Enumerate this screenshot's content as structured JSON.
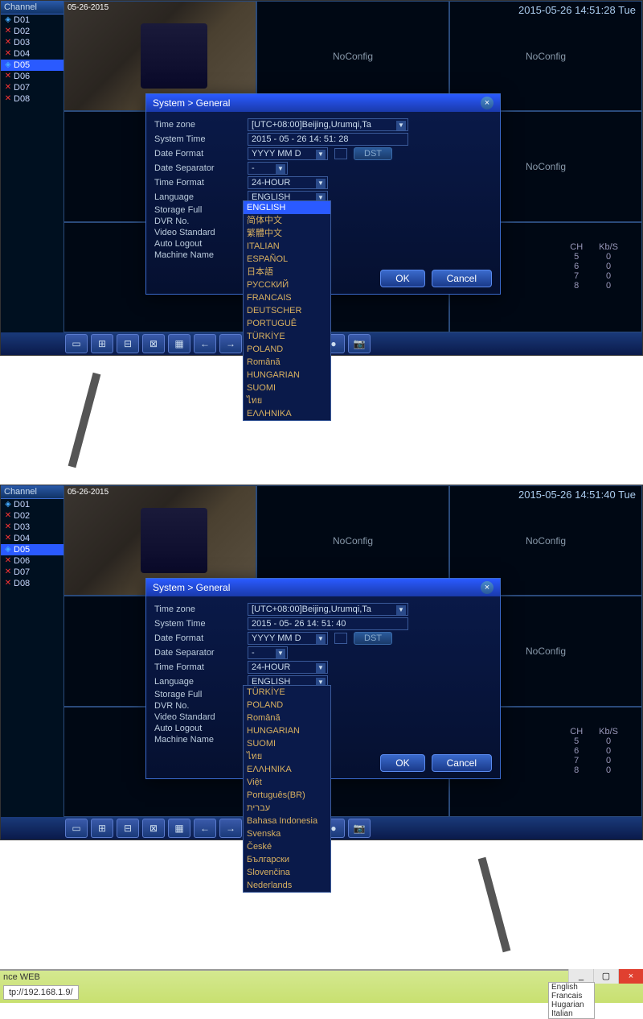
{
  "sidebar": {
    "title": "Channel",
    "channels": [
      {
        "id": "D01",
        "status": "rec"
      },
      {
        "id": "D02",
        "status": "x"
      },
      {
        "id": "D03",
        "status": "x"
      },
      {
        "id": "D04",
        "status": "x"
      },
      {
        "id": "D05",
        "status": "rec",
        "sel": true
      },
      {
        "id": "D06",
        "status": "x"
      },
      {
        "id": "D07",
        "status": "x"
      },
      {
        "id": "D08",
        "status": "x"
      }
    ]
  },
  "screen1": {
    "clock": "2015-05-26 14:51:28 Tue",
    "cam_ts": "05-26-2015",
    "noconfig": "NoConfig",
    "kbs": {
      "hdr_ch": "CH",
      "hdr_kb": "Kb/S",
      "rows": [
        [
          "5",
          "0"
        ],
        [
          "6",
          "0"
        ],
        [
          "7",
          "0"
        ],
        [
          "8",
          "0"
        ]
      ]
    },
    "dialog": {
      "title": "System > General",
      "labels": {
        "tz": "Time zone",
        "systime": "System Time",
        "datefmt": "Date Format",
        "datesep": "Date Separator",
        "timefmt": "Time Format",
        "lang": "Language",
        "storage": "Storage Full",
        "dvrno": "DVR No.",
        "vstd": "Video Standard",
        "autolog": "Auto Logout",
        "mname": "Machine Name"
      },
      "values": {
        "tz": "[UTC+08:00]Beijing,Urumqi,Ta",
        "systime": "2015 - 05 - 26  14: 51: 28",
        "datefmt": "YYYY MM D",
        "datesep": "-",
        "timefmt": "24-HOUR",
        "lang": "ENGLISH"
      },
      "dst": "DST",
      "langs": [
        "ENGLISH",
        "简体中文",
        "繁體中文",
        "ITALIAN",
        "ESPAÑOL",
        "日本語",
        "РУССКИЙ",
        "FRANCAIS",
        "DEUTSCHER",
        "PORTUGUÊ",
        "TÜRKİYE",
        "POLAND",
        "Română",
        "HUNGARIAN",
        "SUOMI",
        "ไทย",
        "ΕΛΛΗΝΙΚΑ"
      ],
      "ok": "OK",
      "cancel": "Cancel"
    }
  },
  "screen2": {
    "clock": "2015-05-26 14:51:40 Tue",
    "cam_ts": "05-26-2015",
    "dialog": {
      "values": {
        "systime": "2015 - 05- 26  14: 51: 40"
      },
      "langs": [
        "TÜRKİYE",
        "POLAND",
        "Română",
        "HUNGARIAN",
        "SUOMI",
        "ไทย",
        "ΕΛΛΗΝΙΚΑ",
        "Việt",
        "Português(BR)",
        "עברית",
        "Bahasa Indonesia",
        "Svenska",
        "České",
        "Български",
        "Slovenčina",
        "Nederlands"
      ]
    }
  },
  "browser": {
    "title": "nce WEB",
    "addr": "tp://192.168.1.9/",
    "langs": [
      "English",
      "Francais",
      "Hugarian",
      "Italian"
    ]
  }
}
